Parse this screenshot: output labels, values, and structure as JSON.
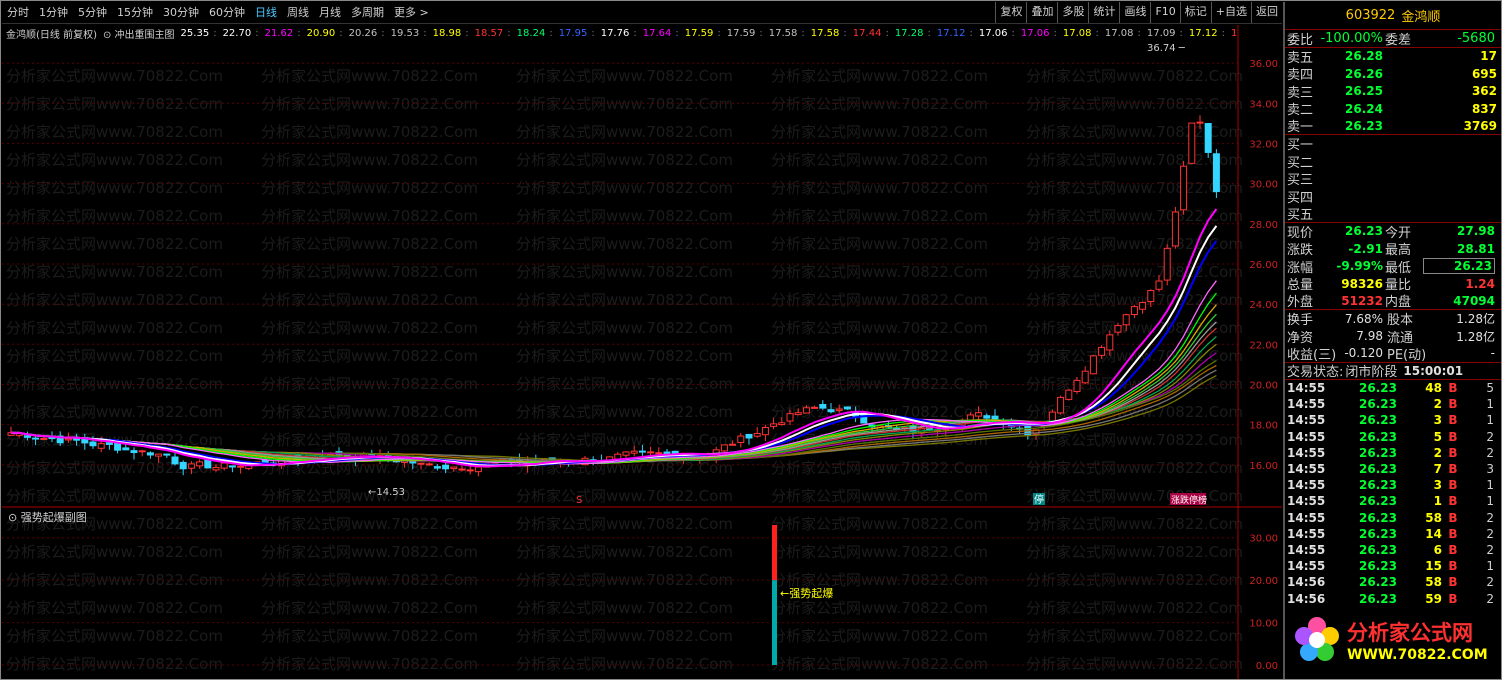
{
  "toolbar": {
    "periods": [
      "分时",
      "1分钟",
      "5分钟",
      "15分钟",
      "30分钟",
      "60分钟",
      "日线",
      "周线",
      "月线",
      "多周期",
      "更多 >"
    ],
    "active_period": "日线",
    "tools": [
      "复权",
      "叠加",
      "多股",
      "统计",
      "画线",
      "F10",
      "标记",
      "+自选",
      "返回"
    ]
  },
  "chart_header": {
    "title": "金鸿顺(日线 前复权)",
    "indicator": "冲出重围主图",
    "values": [
      {
        "v": "25.35",
        "c": "#ffffff"
      },
      {
        "v": "22.70",
        "c": "#ffffff"
      },
      {
        "v": "21.62",
        "c": "#ff00ff"
      },
      {
        "v": "20.90",
        "c": "#ffff00"
      },
      {
        "v": "20.26",
        "c": "#c0c0c0"
      },
      {
        "v": "19.53",
        "c": "#c0c0c0"
      },
      {
        "v": "18.98",
        "c": "#ffff00"
      },
      {
        "v": "18.57",
        "c": "#ff3333"
      },
      {
        "v": "18.24",
        "c": "#00ff66"
      },
      {
        "v": "17.95",
        "c": "#3366ff"
      },
      {
        "v": "17.76",
        "c": "#ffffff"
      },
      {
        "v": "17.64",
        "c": "#ff00ff"
      },
      {
        "v": "17.59",
        "c": "#ffff00"
      },
      {
        "v": "17.59",
        "c": "#c0c0c0"
      },
      {
        "v": "17.58",
        "c": "#c0c0c0"
      },
      {
        "v": "17.58",
        "c": "#ffff00"
      },
      {
        "v": "17.44",
        "c": "#ff3333"
      },
      {
        "v": "17.28",
        "c": "#00ff66"
      },
      {
        "v": "17.12",
        "c": "#3366ff"
      },
      {
        "v": "17.06",
        "c": "#ffffff"
      },
      {
        "v": "17.06",
        "c": "#ff00ff"
      },
      {
        "v": "17.08",
        "c": "#ffff00"
      },
      {
        "v": "17.08",
        "c": "#c0c0c0"
      },
      {
        "v": "17.09",
        "c": "#c0c0c0"
      },
      {
        "v": "17.12",
        "c": "#ffff00"
      },
      {
        "v": "17.14",
        "c": "#ff3333"
      },
      {
        "v": "17.17",
        "c": "#00ff66"
      }
    ]
  },
  "main_chart": {
    "y_ticks": [
      "36.00",
      "34.00",
      "32.00",
      "30.00",
      "28.00",
      "26.00",
      "24.00",
      "22.00",
      "20.00",
      "18.00",
      "16.00"
    ],
    "high_label": "36.74",
    "low_label": "14.53",
    "watermark": "分析家公式网www.70822.Com",
    "markers": [
      "S",
      "停",
      "涨跌停榜"
    ]
  },
  "sub_chart": {
    "title": "强势起爆副图",
    "y_ticks": [
      "30.00",
      "20.00",
      "10.00",
      "0.00"
    ],
    "signal_label": "←强势起爆",
    "signal_value_red": 20,
    "signal_value_total": 40
  },
  "panel": {
    "code": "603922",
    "name": "金鸿顺",
    "webi": {
      "label": "委比",
      "value": "-100.00%",
      "label2": "委差",
      "value2": "-5680"
    },
    "asks": [
      {
        "label": "卖五",
        "price": "26.28",
        "vol": "17"
      },
      {
        "label": "卖四",
        "price": "26.26",
        "vol": "695"
      },
      {
        "label": "卖三",
        "price": "26.25",
        "vol": "362"
      },
      {
        "label": "卖二",
        "price": "26.24",
        "vol": "837"
      },
      {
        "label": "卖一",
        "price": "26.23",
        "vol": "3769"
      }
    ],
    "bids": [
      {
        "label": "买一"
      },
      {
        "label": "买二"
      },
      {
        "label": "买三"
      },
      {
        "label": "买四"
      },
      {
        "label": "买五"
      }
    ],
    "stats": [
      {
        "l1": "现价",
        "v1": "26.23",
        "c1": "#00ff33",
        "l2": "今开",
        "v2": "27.98",
        "c2": "#00ff33",
        "box2": false
      },
      {
        "l1": "涨跌",
        "v1": "-2.91",
        "c1": "#00ff33",
        "l2": "最高",
        "v2": "28.81",
        "c2": "#00ff33",
        "box2": false
      },
      {
        "l1": "涨幅",
        "v1": "-9.99%",
        "c1": "#00ff33",
        "l2": "最低",
        "v2": "26.23",
        "c2": "#00ff33",
        "box2": true
      },
      {
        "l1": "总量",
        "v1": "98326",
        "c1": "#ffff00",
        "l2": "量比",
        "v2": "1.24",
        "c2": "#ff3333",
        "box2": false
      },
      {
        "l1": "外盘",
        "v1": "51232",
        "c1": "#ff3333",
        "l2": "内盘",
        "v2": "47094",
        "c2": "#00ff33",
        "box2": false
      }
    ],
    "stats2": [
      {
        "l1": "换手",
        "v1": "7.68%",
        "l2": "股本",
        "v2": "1.28亿"
      },
      {
        "l1": "净资",
        "v1": "7.98",
        "l2": "流通",
        "v2": "1.28亿"
      },
      {
        "l1": "收益(三)",
        "v1": "-0.120",
        "l2": "PE(动)",
        "v2": "-"
      }
    ],
    "trade_status": {
      "label": "交易状态:",
      "value": "闭市阶段",
      "time": "15:00:01"
    },
    "ticks": [
      {
        "t": "14:55",
        "p": "26.23",
        "v": "48",
        "bs": "B",
        "n": "5"
      },
      {
        "t": "14:55",
        "p": "26.23",
        "v": "2",
        "bs": "B",
        "n": "1"
      },
      {
        "t": "14:55",
        "p": "26.23",
        "v": "3",
        "bs": "B",
        "n": "1"
      },
      {
        "t": "14:55",
        "p": "26.23",
        "v": "5",
        "bs": "B",
        "n": "2"
      },
      {
        "t": "14:55",
        "p": "26.23",
        "v": "2",
        "bs": "B",
        "n": "2"
      },
      {
        "t": "14:55",
        "p": "26.23",
        "v": "7",
        "bs": "B",
        "n": "3"
      },
      {
        "t": "14:55",
        "p": "26.23",
        "v": "3",
        "bs": "B",
        "n": "1"
      },
      {
        "t": "14:55",
        "p": "26.23",
        "v": "1",
        "bs": "B",
        "n": "1"
      },
      {
        "t": "14:55",
        "p": "26.23",
        "v": "58",
        "bs": "B",
        "n": "2"
      },
      {
        "t": "14:55",
        "p": "26.23",
        "v": "14",
        "bs": "B",
        "n": "2"
      },
      {
        "t": "14:55",
        "p": "26.23",
        "v": "6",
        "bs": "B",
        "n": "2"
      },
      {
        "t": "14:55",
        "p": "26.23",
        "v": "15",
        "bs": "B",
        "n": "1"
      },
      {
        "t": "14:56",
        "p": "26.23",
        "v": "58",
        "bs": "B",
        "n": "2"
      },
      {
        "t": "14:56",
        "p": "26.23",
        "v": "59",
        "bs": "B",
        "n": "2"
      }
    ]
  },
  "logo": {
    "line1": "分析家公式网",
    "line2": "WWW.70822.COM"
  }
}
